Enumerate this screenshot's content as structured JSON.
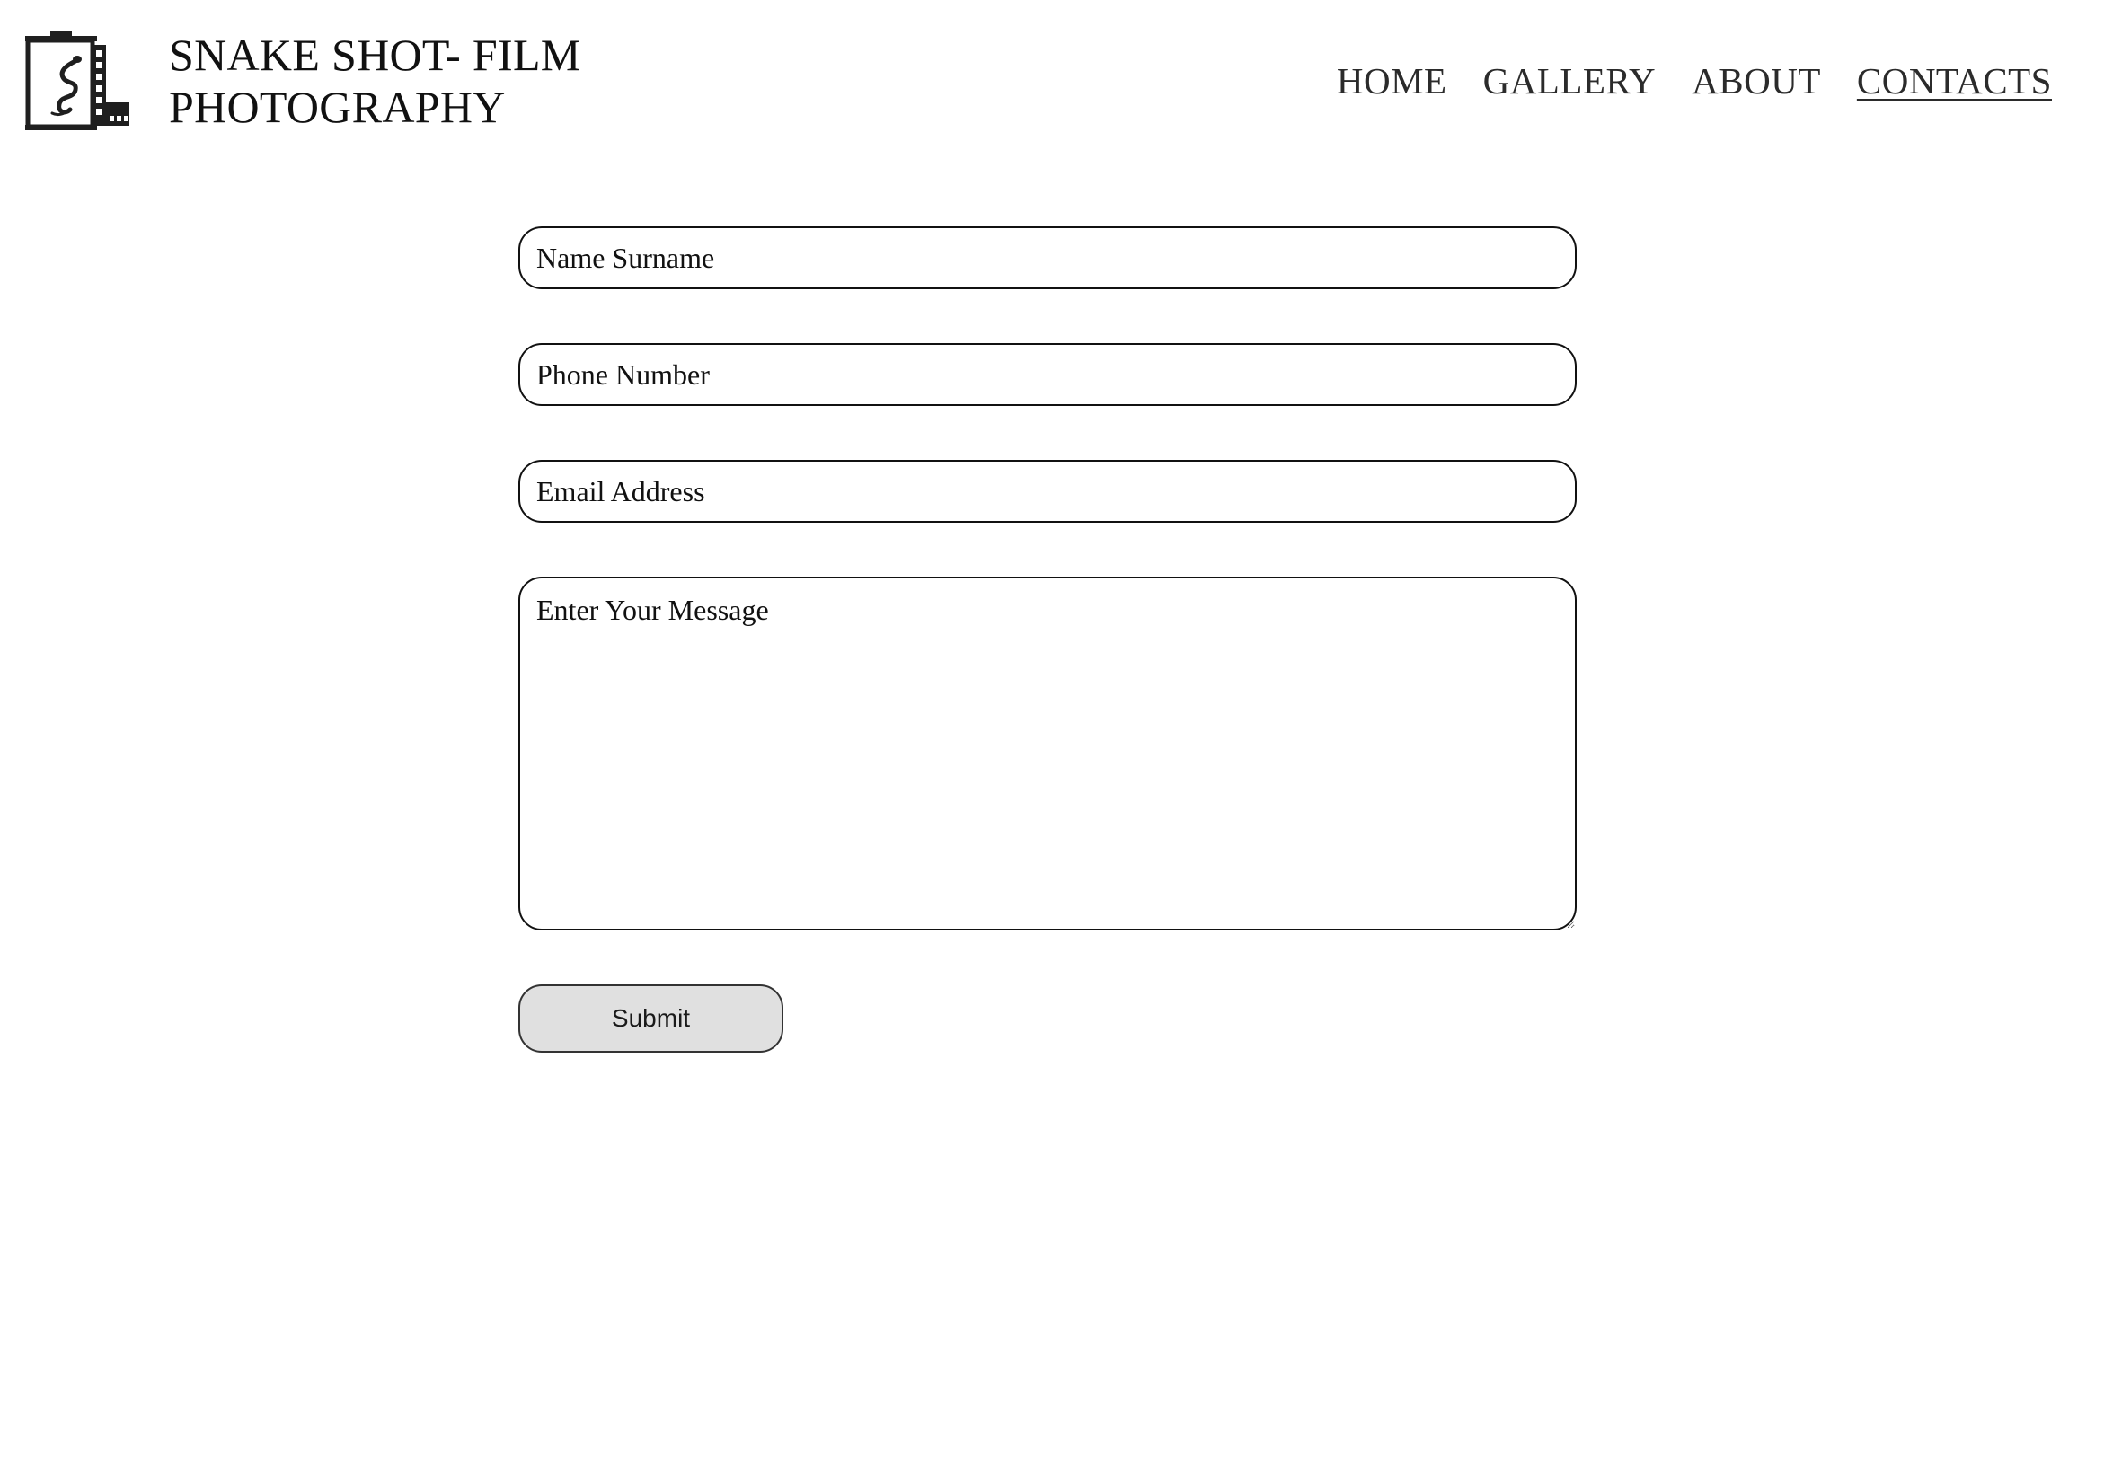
{
  "header": {
    "logo_icon": "film-canister-snake-icon",
    "title_line1": "SNAKE SHOT- FILM",
    "title_line2": "PHOTOGRAPHY"
  },
  "nav": {
    "items": [
      {
        "label": "HOME",
        "active": false
      },
      {
        "label": "GALLERY",
        "active": false
      },
      {
        "label": "ABOUT",
        "active": false
      },
      {
        "label": "CONTACTS",
        "active": true
      }
    ]
  },
  "form": {
    "name_placeholder": "Name Surname",
    "phone_placeholder": "Phone Number",
    "email_placeholder": "Email Address",
    "message_placeholder": "Enter Your Message",
    "submit_label": "Submit"
  },
  "colors": {
    "text": "#111111",
    "nav_text": "#2b2b2b",
    "button_bg": "#e0e0e0",
    "background": "#ffffff"
  }
}
